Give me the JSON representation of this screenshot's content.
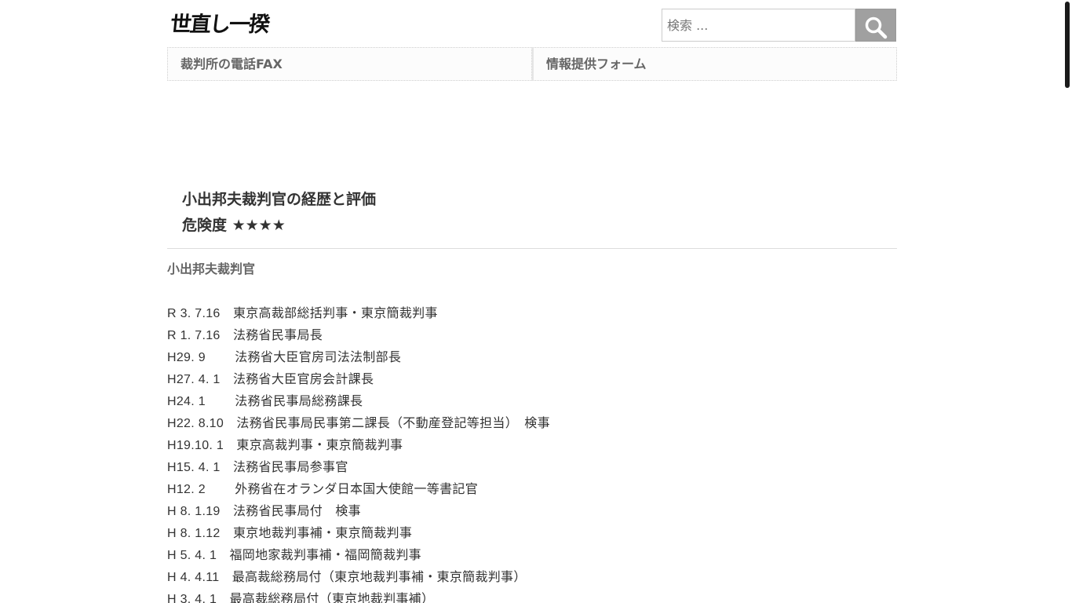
{
  "header": {
    "logo_text": "世直し一揆",
    "search": {
      "placeholder": "検索 ...",
      "value": ""
    }
  },
  "nav": {
    "items": [
      {
        "label": "裁判所の電話FAX"
      },
      {
        "label": "情報提供フォーム"
      }
    ]
  },
  "article": {
    "title": "小出邦夫裁判官の経歴と評価",
    "danger_label": "危険度 ★★★★",
    "subject_name": "小出邦夫裁判官",
    "career": [
      {
        "date": "R 3. 7.16　",
        "post": "東京高裁部総括判事・東京簡裁判事"
      },
      {
        "date": "R 1. 7.16　",
        "post": "法務省民事局長"
      },
      {
        "date": "H29. 9　　 ",
        "post": "法務省大臣官房司法法制部長"
      },
      {
        "date": "H27. 4. 1　",
        "post": "法務省大臣官房会計課長"
      },
      {
        "date": "H24. 1　　 ",
        "post": "法務省民事局総務課長"
      },
      {
        "date": "H22. 8.10　",
        "post": "法務省民事局民事第二課長（不動産登記等担当）　検事"
      },
      {
        "date": "H19.10. 1　",
        "post": "東京高裁判事・東京簡裁判事"
      },
      {
        "date": "H15. 4. 1　",
        "post": "法務省民事局参事官"
      },
      {
        "date": "H12. 2　　 ",
        "post": "外務省在オランダ日本国大使館一等書記官"
      },
      {
        "date": "H 8. 1.19　",
        "post": "法務省民事局付　検事"
      },
      {
        "date": "H 8. 1.12　",
        "post": "東京地裁判事補・東京簡裁判事"
      },
      {
        "date": "H 5. 4. 1　",
        "post": "福岡地家裁判事補・福岡簡裁判事"
      },
      {
        "date": "H 4. 4.11　",
        "post": "最高裁総務局付（東京地裁判事補・東京簡裁判事）"
      },
      {
        "date": "H 3. 4. 1　",
        "post": "最高裁総務局付（東京地裁判事補）"
      }
    ]
  }
}
